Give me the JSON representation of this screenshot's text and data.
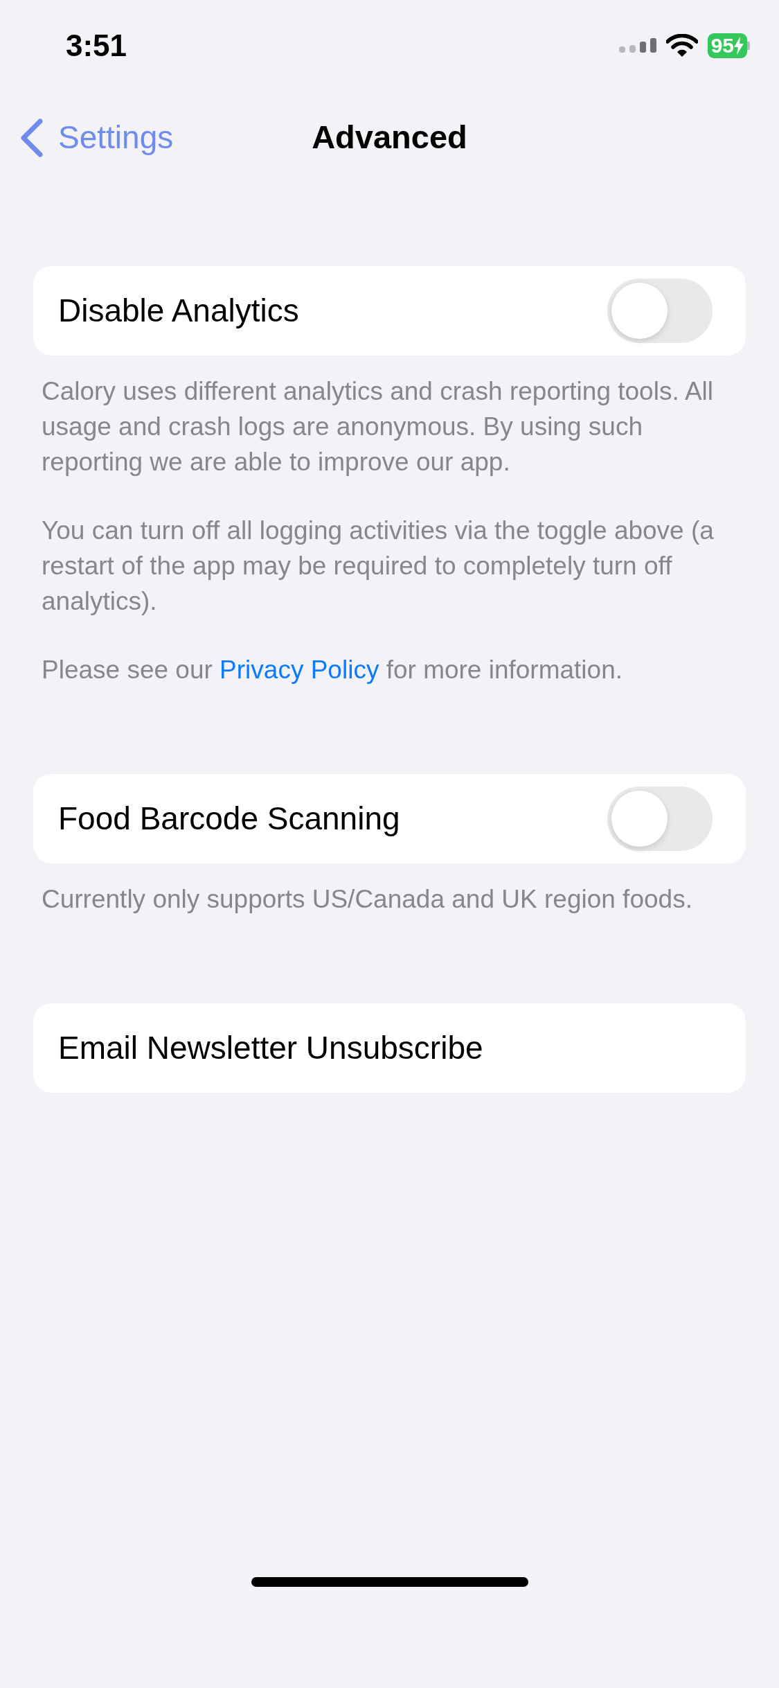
{
  "status_bar": {
    "time": "3:51",
    "battery": "95",
    "charging": true
  },
  "nav": {
    "back": "Settings",
    "title": "Advanced"
  },
  "sections": [
    {
      "kind": "toggle",
      "label": "Disable Analytics",
      "on": false,
      "footer": [
        {
          "text": "Calory uses different analytics and crash reporting tools. All usage and crash logs are anonymous. By using such reporting we are able to improve our app."
        },
        {
          "text": "You can turn off all logging activities via the toggle above (a restart of the app may be required to completely turn off analytics)."
        },
        {
          "before": "Please see our",
          "link": "Privacy Policy",
          "after": "for more information."
        }
      ]
    },
    {
      "kind": "toggle",
      "label": "Food Barcode Scanning",
      "on": false,
      "footer": [
        {
          "text": "Currently only supports US/Canada and UK region foods."
        }
      ]
    },
    {
      "kind": "button",
      "label": "Email Newsletter Unsubscribe"
    }
  ]
}
